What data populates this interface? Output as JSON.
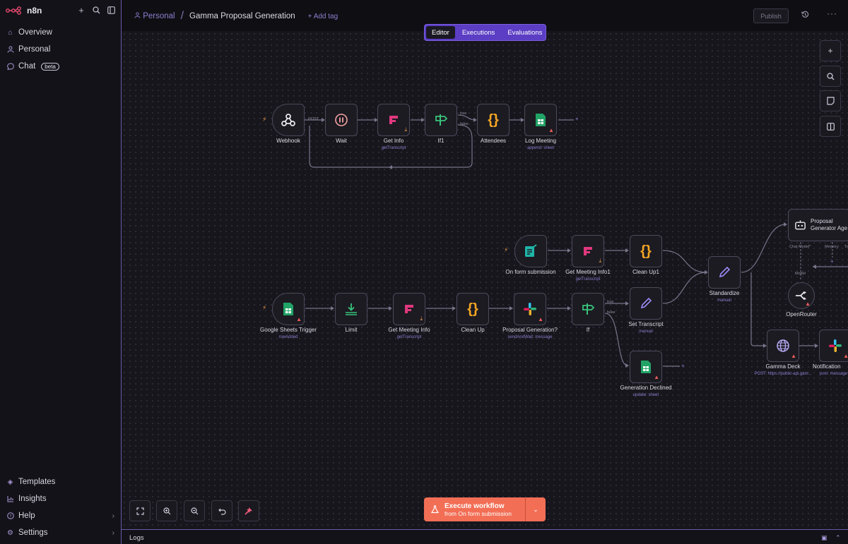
{
  "app": {
    "brand": "n8n"
  },
  "sidebar": {
    "top_items": [
      {
        "label": "Overview",
        "icon": "home-icon"
      },
      {
        "label": "Personal",
        "icon": "user-icon"
      },
      {
        "label": "Chat",
        "icon": "chat-icon",
        "badge": "beta"
      }
    ],
    "bottom_items": [
      {
        "label": "Templates",
        "icon": "templates-icon"
      },
      {
        "label": "Insights",
        "icon": "insights-icon"
      },
      {
        "label": "Help",
        "icon": "help-icon"
      },
      {
        "label": "Settings",
        "icon": "settings-icon"
      }
    ]
  },
  "header": {
    "project": "Personal",
    "workflow_name": "Gamma Proposal Generation",
    "add_tag": "+ Add tag",
    "publish": "Publish"
  },
  "tabs": [
    {
      "label": "Editor",
      "active": true
    },
    {
      "label": "Executions",
      "active": false
    },
    {
      "label": "Evaluations",
      "active": false
    }
  ],
  "nodes": {
    "webhook": {
      "label": "Webhook"
    },
    "wait": {
      "label": "Wait"
    },
    "get_info": {
      "label": "Get Info",
      "sub": "getTranscript"
    },
    "if1": {
      "label": "If1"
    },
    "attendees": {
      "label": "Attendees"
    },
    "log_meeting": {
      "label": "Log Meeting",
      "sub": "append: sheet"
    },
    "form": {
      "label": "On form submission"
    },
    "get_meeting_info1": {
      "label": "Get Meeting Info1",
      "sub": "getTranscript"
    },
    "clean_up1": {
      "label": "Clean Up1"
    },
    "standardize": {
      "label": "Standardize",
      "sub": "manual"
    },
    "agent": {
      "label": "Proposal Generator Age"
    },
    "openrouter": {
      "label": "OpenRouter"
    },
    "sheets_trigger": {
      "label": "Google Sheets Trigger",
      "sub": "rowAdded"
    },
    "limit": {
      "label": "Limit"
    },
    "get_meeting_info": {
      "label": "Get Meeting Info",
      "sub": "getTranscript"
    },
    "clean_up": {
      "label": "Clean Up"
    },
    "proposal_gen": {
      "label": "Proposal Generation?",
      "sub": "sendAndWait: message"
    },
    "if": {
      "label": "If"
    },
    "set_transcript": {
      "label": "Set Transcript",
      "sub": "manual"
    },
    "gen_declined": {
      "label": "Generation Declined",
      "sub": "update: sheet"
    },
    "gamma_deck": {
      "label": "Gamma Deck",
      "sub": "POST: https://public-api.gam..."
    },
    "notification": {
      "label": "Notification",
      "sub": "post: message"
    }
  },
  "edge_labels": {
    "post": "POST",
    "true1": "true",
    "false1": "false",
    "true2": "true",
    "false2": "false",
    "chat_model": "Chat Model*",
    "memory": "Memory",
    "tool": "To",
    "model": "Model"
  },
  "execute": {
    "title": "Execute workflow",
    "subtitle": "from On form submission"
  },
  "logs": {
    "label": "Logs"
  },
  "colors": {
    "accent": "#5b3ec4",
    "execute": "#f26e55",
    "warning": "#f05b5b"
  }
}
